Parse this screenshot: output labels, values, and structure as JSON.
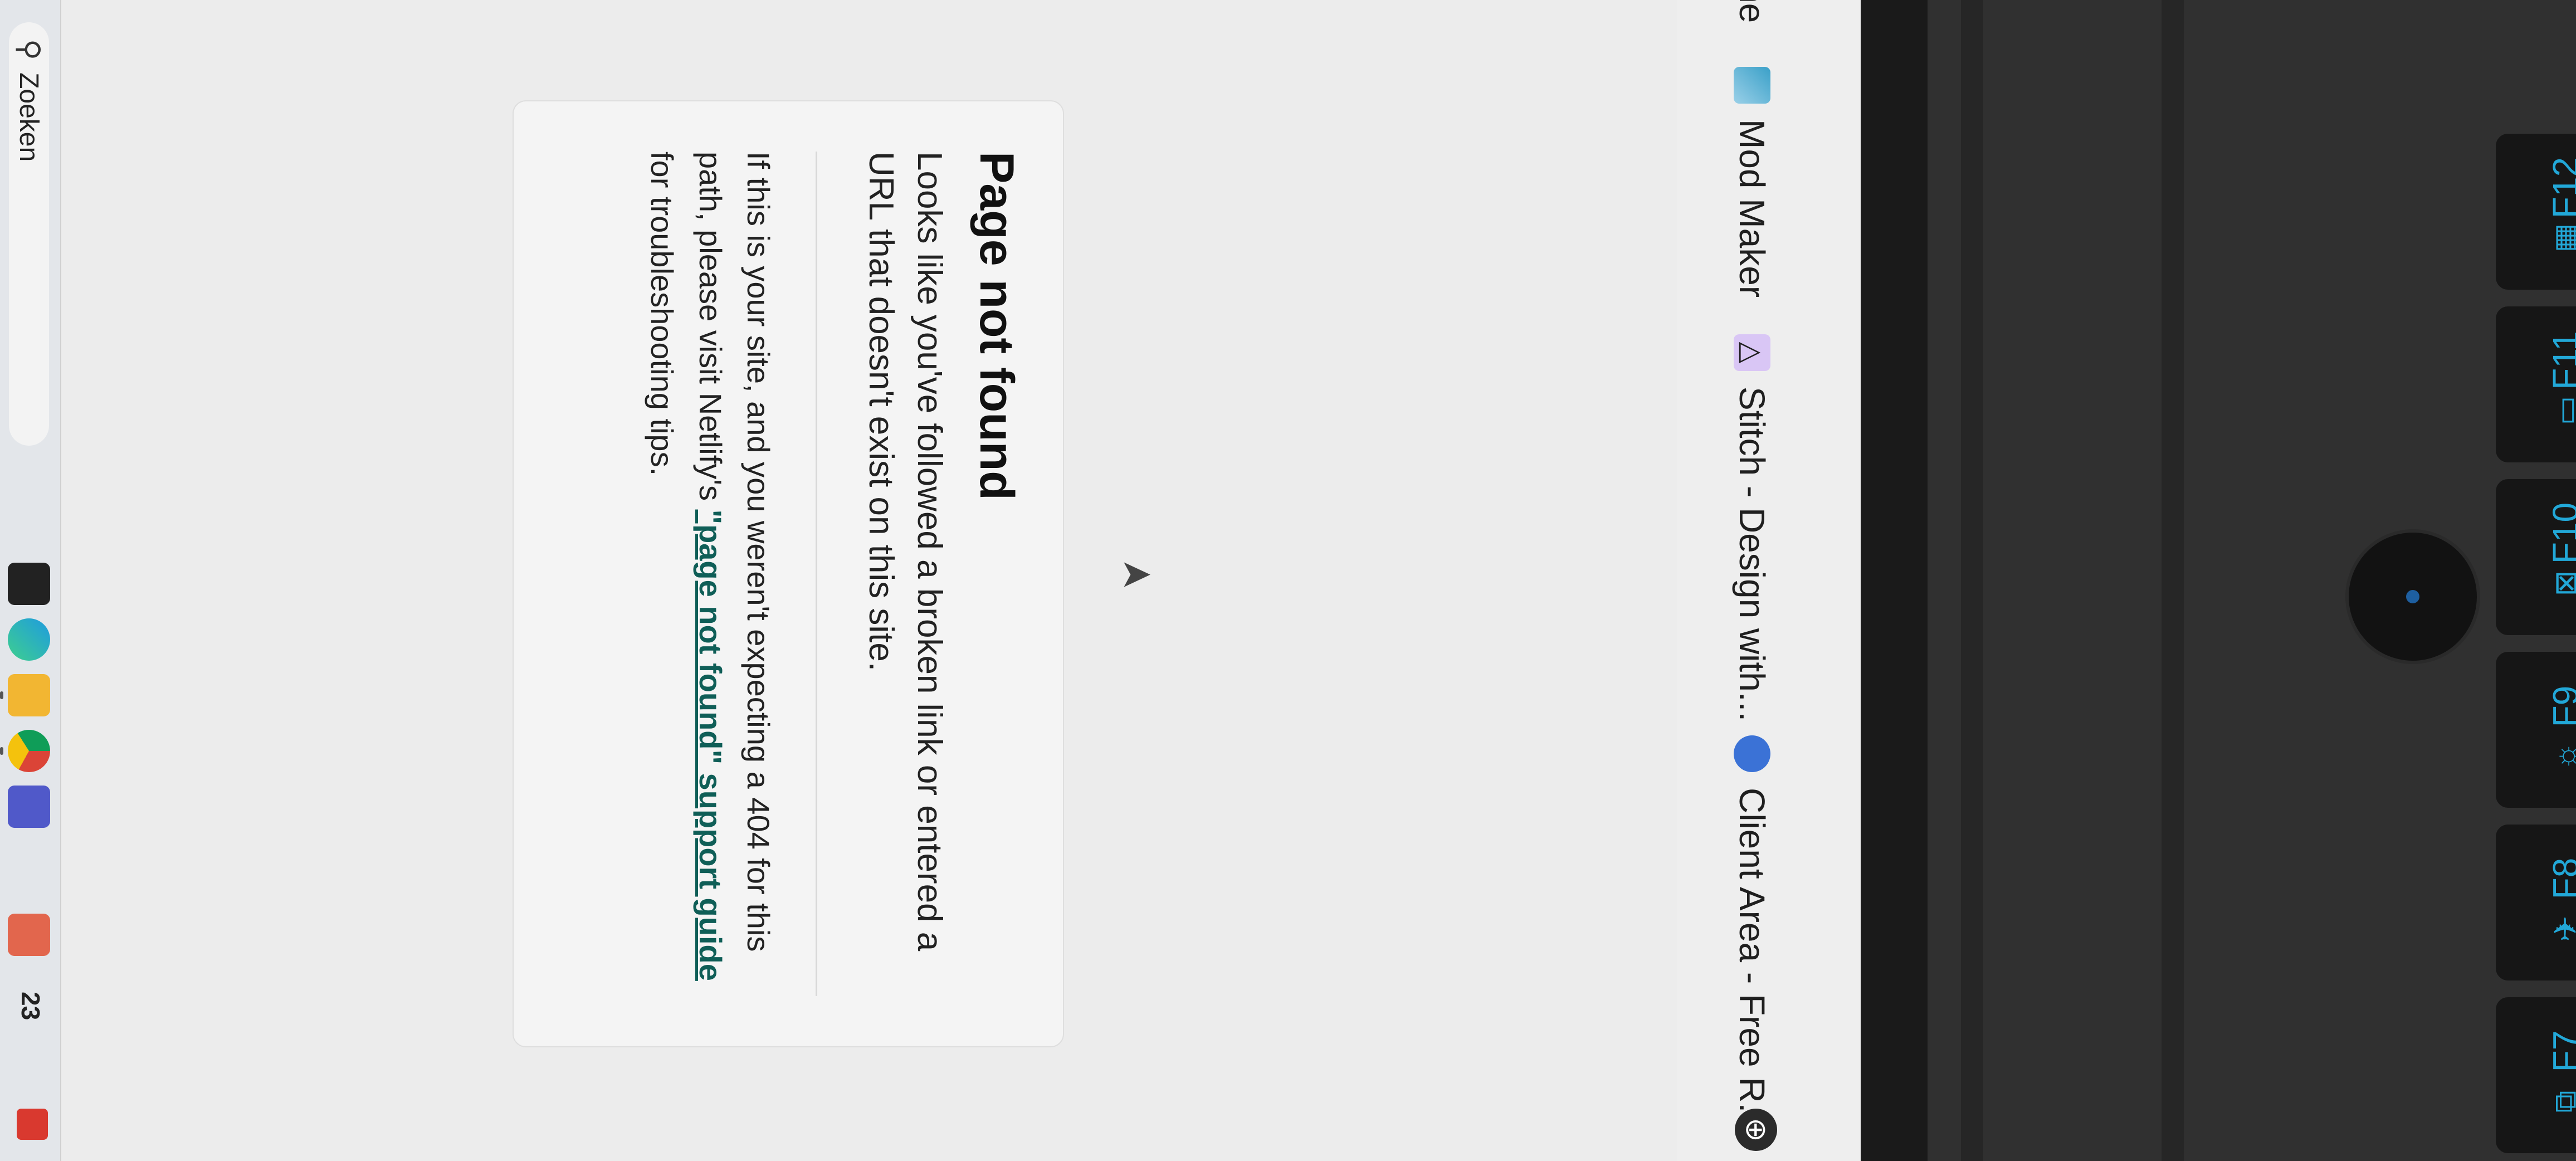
{
  "bookmarks": [
    {
      "label": "ne",
      "icon": "tab-fragment"
    },
    {
      "label": "Mod Maker",
      "icon": "mod-maker-icon"
    },
    {
      "label": "Stitch - Design with...",
      "icon": "stitch-icon"
    },
    {
      "label": "Client Area - Free R...",
      "icon": "client-area-icon"
    }
  ],
  "page": {
    "title": "Page not found",
    "lead": "Looks like you've followed a broken link or entered a URL that doesn't exist on this site.",
    "note_prefix": "If this is your site, and you weren't expecting a 404 for this path, please visit Netlify's ",
    "note_link": "\"page not found\" support guide",
    "note_suffix": " for troubleshooting tips."
  },
  "taskbar": {
    "search_placeholder": "Zoeken",
    "notification_count": "23",
    "apps": [
      "task-view-icon",
      "edge-icon",
      "file-explorer-icon",
      "chrome-icon",
      "teams-icon",
      "mail-icon"
    ]
  },
  "keyboard": {
    "keys": [
      {
        "label": "F7",
        "icon": "display-switch-icon"
      },
      {
        "label": "F8",
        "icon": "airplane-icon"
      },
      {
        "label": "F9",
        "icon": "brightness-icon"
      },
      {
        "label": "F10",
        "icon": "screenshot-icon"
      },
      {
        "label": "F11",
        "icon": "keyboard-backlight-icon"
      },
      {
        "label": "F12",
        "icon": "calculator-icon"
      }
    ]
  },
  "colors": {
    "link": "#0f5e57",
    "key_accent": "#22a8d8"
  }
}
